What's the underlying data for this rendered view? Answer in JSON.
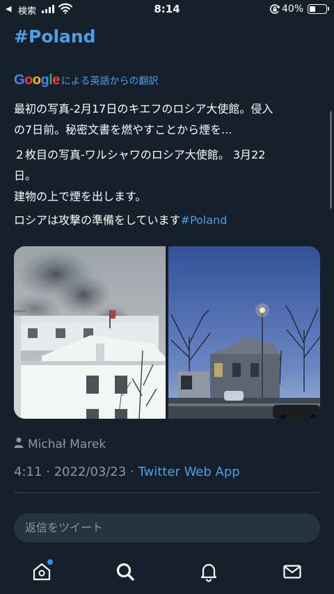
{
  "status_bar": {
    "back_label": "◀",
    "carrier": "検索",
    "time": "8:14",
    "battery_percent": "40%",
    "battery_level": 0.4
  },
  "tweet": {
    "hashtag_title": "#Poland",
    "translate_label": "による英語からの翻訳",
    "google_letters": [
      {
        "ch": "G",
        "color": "#4285f4"
      },
      {
        "ch": "o",
        "color": "#ea4335"
      },
      {
        "ch": "o",
        "color": "#fbbc05"
      },
      {
        "ch": "g",
        "color": "#4285f4"
      },
      {
        "ch": "l",
        "color": "#34a853"
      },
      {
        "ch": "e",
        "color": "#ea4335"
      }
    ],
    "para1_line1": "最初の写真-2月17日のキエフのロシア大使館。侵入",
    "para1_line2": "の7日前。秘密文書を燃やすことから煙を...",
    "para2_line1": " ２枚目の写真-ワルシャワのロシア大使館。 3月22",
    "para2_line2": "日。",
    "para2_line3": "建物の上で煙を出します。",
    "para3_text": "ロシアは攻撃の準備をしています",
    "para3_tag": "#Poland",
    "author": "Michał Marek",
    "time": "4:11",
    "separator": " · ",
    "date": "2022/03/23",
    "app": "Twitter Web App"
  },
  "reply": {
    "placeholder": "返信をツイート"
  },
  "tabs": {
    "home": "home-icon",
    "search": "search-icon",
    "notifications": "bell-icon",
    "messages": "mail-icon"
  },
  "colors": {
    "background": "#15202b",
    "link": "#4a9fe8",
    "secondary_text": "#8b98a5",
    "notification_dot": "#1d9bf0"
  }
}
